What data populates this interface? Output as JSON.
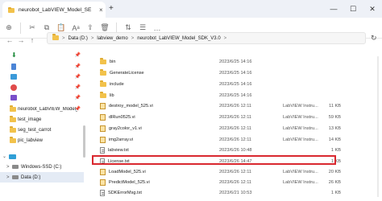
{
  "titlebar": {
    "tab_title": "neurobot_LabVIEW_Model_SE",
    "tab_close": "×",
    "new_tab": "+",
    "minimize": "—",
    "maximize": "☐",
    "close": "✕"
  },
  "toolbar": {
    "new": "⊕",
    "cut": "✂",
    "copy": "⧉",
    "paste": "📋",
    "rename": "Aᵃ",
    "share": "⇪",
    "delete": "🗑",
    "sort": "⇅",
    "view": "☰",
    "more": "…"
  },
  "nav": {
    "back": "←",
    "forward": "→",
    "up": "↑",
    "refresh": "↻"
  },
  "address": {
    "crumbs": [
      "Data (D:)",
      "labview_demo",
      "neurobot_LabVIEW_Model_SDK_V3.0"
    ],
    "separator": ">",
    "home_sep": "›"
  },
  "sidebar": {
    "items": [
      {
        "label": "",
        "icon": "download-icon"
      },
      {
        "label": "",
        "icon": "document-icon"
      },
      {
        "label": "",
        "icon": "picture-icon"
      },
      {
        "label": "",
        "icon": "music-icon"
      },
      {
        "label": "",
        "icon": "video-icon"
      },
      {
        "label": "neurobot_LabVIEW_Model_SDI",
        "icon": "folder-icon"
      },
      {
        "label": "test_image",
        "icon": "folder-icon"
      },
      {
        "label": "seg_test_carrot",
        "icon": "folder-icon"
      },
      {
        "label": "pic_labview",
        "icon": "folder-icon"
      },
      {
        "label": "",
        "icon": "this-pc-icon"
      },
      {
        "label": "Windows-SSD (C:)",
        "icon": "drive-icon"
      },
      {
        "label": "Data (D:)",
        "icon": "drive-icon"
      }
    ],
    "pin": "📌",
    "expand": ">"
  },
  "files": [
    {
      "name": "bin",
      "date": "2023/6/25 14:16",
      "type": "",
      "size": "",
      "kind": "folder"
    },
    {
      "name": "GenerateLicense",
      "date": "2023/6/25 14:16",
      "type": "",
      "size": "",
      "kind": "folder"
    },
    {
      "name": "include",
      "date": "2023/6/25 14:16",
      "type": "",
      "size": "",
      "kind": "folder"
    },
    {
      "name": "lib",
      "date": "2023/6/25 14:16",
      "type": "",
      "size": "",
      "kind": "folder"
    },
    {
      "name": "destroy_model_525.vi",
      "date": "2023/6/26 12:11",
      "type": "LabVIEW Instru...",
      "size": "11 KB",
      "kind": "vi"
    },
    {
      "name": "dlRun0525.vi",
      "date": "2023/6/26 12:11",
      "type": "LabVIEW Instru...",
      "size": "59 KB",
      "kind": "vi"
    },
    {
      "name": "gray2color_v1.vi",
      "date": "2023/6/26 12:11",
      "type": "LabVIEW Instru...",
      "size": "13 KB",
      "kind": "vi"
    },
    {
      "name": "img2array.vi",
      "date": "2023/6/26 12:11",
      "type": "LabVIEW Instru...",
      "size": "14 KB",
      "kind": "vi"
    },
    {
      "name": "labview.txt",
      "date": "2023/6/26 10:48",
      "type": "",
      "size": "1 KB",
      "kind": "txt"
    },
    {
      "name": "License.txt",
      "date": "2023/6/26 14:47",
      "type": "",
      "size": "1 KB",
      "kind": "txt"
    },
    {
      "name": "LoadModel_525.vi",
      "date": "2023/6/26 12:11",
      "type": "LabVIEW Instru...",
      "size": "20 KB",
      "kind": "vi"
    },
    {
      "name": "PredictModel_525.vi",
      "date": "2023/6/26 12:11",
      "type": "LabVIEW Instru...",
      "size": "26 KB",
      "kind": "vi"
    },
    {
      "name": "SDKErrorMsg.txt",
      "date": "2023/6/21 10:53",
      "type": "",
      "size": "1 KB",
      "kind": "txt"
    }
  ],
  "highlight_color": "#d9282f"
}
